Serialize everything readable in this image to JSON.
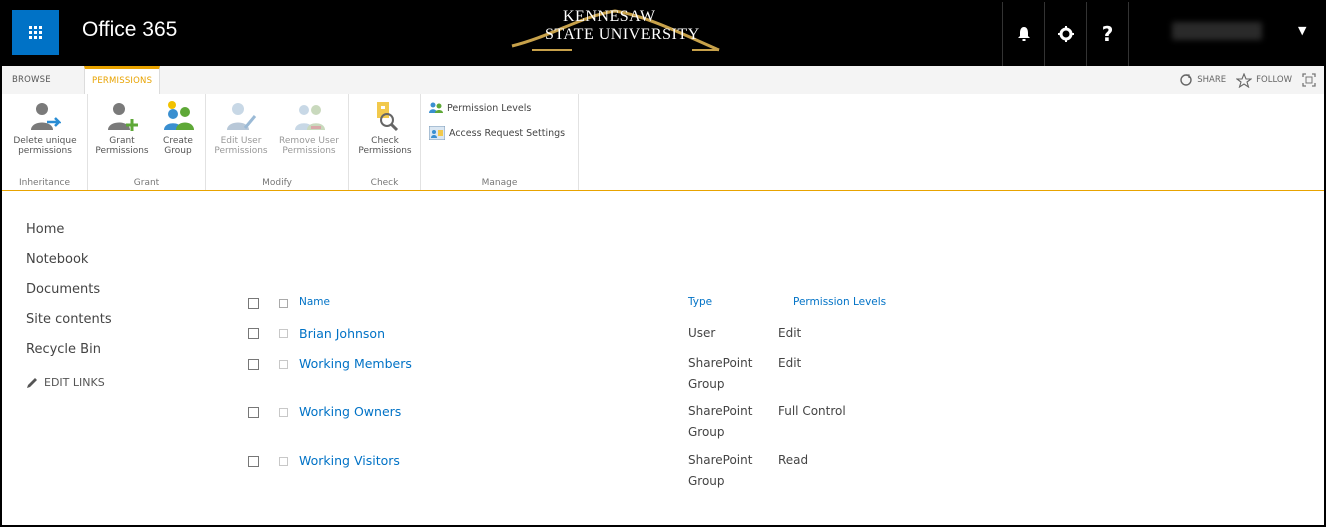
{
  "suite": {
    "brand": "Office 365",
    "logo_line1": "KENNESAW",
    "logo_line2": "STATE UNIVERSITY",
    "icons": [
      "bell-icon",
      "gear-icon",
      "help-icon"
    ],
    "help_glyph": "?"
  },
  "tabs": {
    "browse": "BROWSE",
    "permissions": "PERMISSIONS"
  },
  "actions": {
    "share": "SHARE",
    "follow": "FOLLOW"
  },
  "ribbon": {
    "groups": {
      "inheritance": "Inheritance",
      "grant": "Grant",
      "modify": "Modify",
      "check": "Check",
      "manage": "Manage"
    },
    "buttons": {
      "delete_unique_1": "Delete unique",
      "delete_unique_2": "permissions",
      "grant_1": "Grant",
      "grant_2": "Permissions",
      "create_1": "Create",
      "create_2": "Group",
      "edit_1": "Edit User",
      "edit_2": "Permissions",
      "remove_1": "Remove User",
      "remove_2": "Permissions",
      "check_1": "Check",
      "check_2": "Permissions",
      "permission_levels": "Permission Levels",
      "access_request": "Access Request Settings"
    }
  },
  "nav": {
    "items": [
      "Home",
      "Notebook",
      "Documents",
      "Site contents",
      "Recycle Bin"
    ],
    "edit_links": "EDIT LINKS"
  },
  "table": {
    "headers": {
      "name": "Name",
      "type": "Type",
      "levels": "Permission Levels"
    },
    "rows": [
      {
        "name": "Brian Johnson",
        "type": "User",
        "level": "Edit"
      },
      {
        "name": "Working Members",
        "type": "SharePoint Group",
        "level": "Edit"
      },
      {
        "name": "Working Owners",
        "type": "SharePoint Group",
        "level": "Full Control"
      },
      {
        "name": "Working Visitors",
        "type": "SharePoint Group",
        "level": "Read"
      }
    ]
  },
  "colors": {
    "accent": "#e8a300",
    "link": "#0072c6",
    "suite_bar": "#000000",
    "waffle": "#0072c6"
  }
}
